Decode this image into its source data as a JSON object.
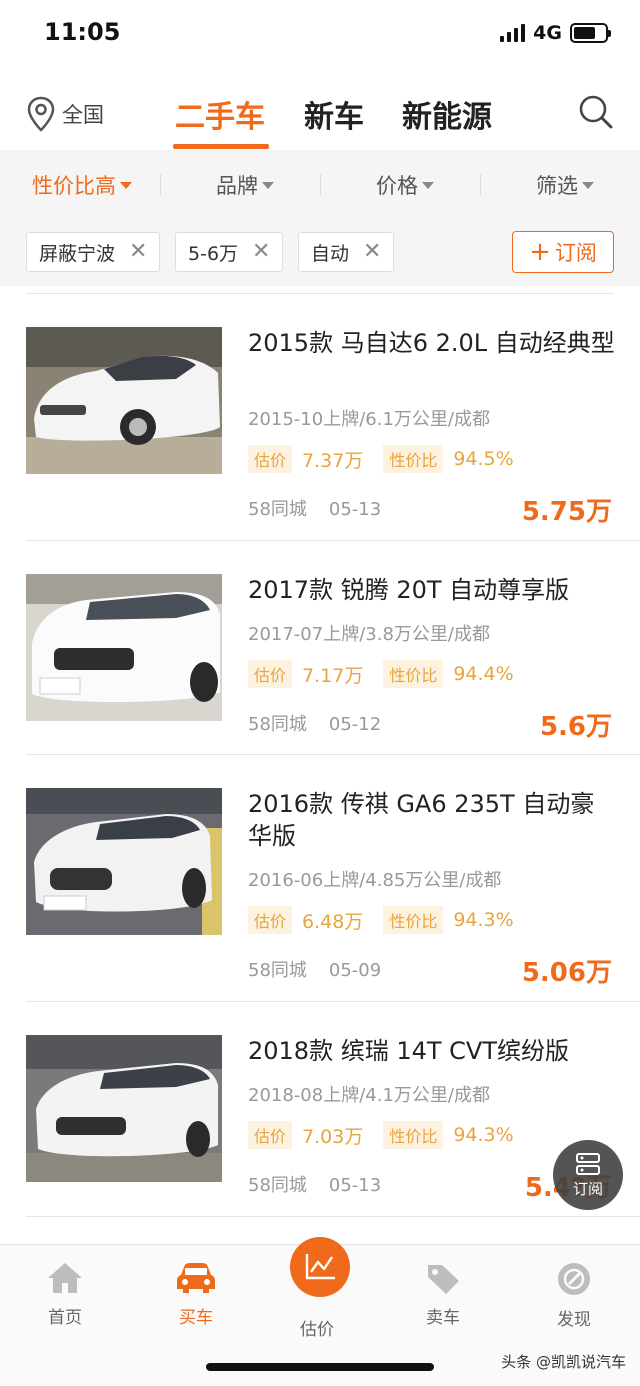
{
  "status_bar": {
    "time": "11:05",
    "network": "4G",
    "battery_level": 0.7
  },
  "header": {
    "location": "全国",
    "tabs": [
      {
        "label": "二手车",
        "active": true
      },
      {
        "label": "新车",
        "active": false
      },
      {
        "label": "新能源",
        "active": false
      }
    ]
  },
  "filters": {
    "sort": "性价比高",
    "brand": "品牌",
    "price": "价格",
    "screen": "筛选",
    "chips": [
      "屏蔽宁波",
      "5-6万",
      "自动"
    ],
    "subscribe": "订阅"
  },
  "labels": {
    "estimate": "估价",
    "value_ratio": "性价比"
  },
  "listings": [
    {
      "title": "2015款 马自达6 2.0L 自动经典型",
      "meta": "2015-10上牌/6.1万公里/成都",
      "estimate": "7.37万",
      "ratio": "94.5%",
      "source": "58同城",
      "date": "05-13",
      "price": "5.75万"
    },
    {
      "title": "2017款 锐腾 20T 自动尊享版",
      "meta": "2017-07上牌/3.8万公里/成都",
      "estimate": "7.17万",
      "ratio": "94.4%",
      "source": "58同城",
      "date": "05-12",
      "price": "5.6万"
    },
    {
      "title": "2016款 传祺 GA6 235T 自动豪华版",
      "meta": "2016-06上牌/4.85万公里/成都",
      "estimate": "6.48万",
      "ratio": "94.3%",
      "source": "58同城",
      "date": "05-09",
      "price": "5.06万"
    },
    {
      "title": "2018款 缤瑞 14T CVT缤纷版",
      "meta": "2018-08上牌/4.1万公里/成都",
      "estimate": "7.03万",
      "ratio": "94.3%",
      "source": "58同城",
      "date": "05-13",
      "price": "5.4?万"
    }
  ],
  "floating_button": {
    "label": "订阅"
  },
  "bottom_nav": {
    "home": "首页",
    "buy": "买车",
    "estimate": "估价",
    "sell": "卖车",
    "discover": "发现"
  },
  "watermark": "头条 @凯凯说汽车",
  "colors": {
    "accent": "#f06a1c",
    "tag_bg": "#fdf1e0",
    "tag_text": "#e9a43c"
  }
}
